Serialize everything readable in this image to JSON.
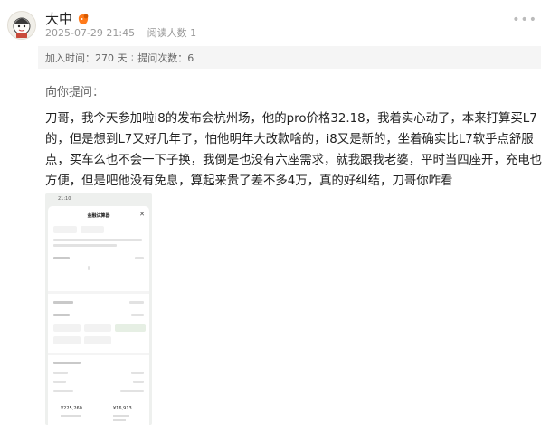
{
  "post": {
    "author": "大中",
    "avatar_icon": "cartoon-avatar-icon",
    "badge_icon": "orange-badge-icon",
    "timestamp": "2025-07-29 21:45",
    "read_count": "阅读人数 1"
  },
  "join_info": {
    "joined": "加入时间：270 天",
    "questions": "提问次数：6"
  },
  "question": {
    "label": "向你提问：",
    "text": "刀哥，我今天参加啦i8的发布会杭州场，他的pro价格32.18，我着实心动了，本来打算买L7的，但是想到L7又好几年了，怕他明年大改款啥的，i8又是新的，坐着确实比L7软乎点舒服点，买车么也不会一下子换，我倒是也没有六座需求，就我跟我老婆，平时当四座开，充电也方便，但是吧他没有免息，算起来贵了差不多4万，真的好纠结，刀哥你咋看"
  },
  "attachment": {
    "status_time": "21:10",
    "sheet_title": "金融试算器",
    "total_left": "¥225,260",
    "total_right": "¥16,913"
  },
  "colors": {
    "meta_gray": "#999999",
    "bar_bg": "#f5f5f5",
    "text_dark": "#222222"
  }
}
